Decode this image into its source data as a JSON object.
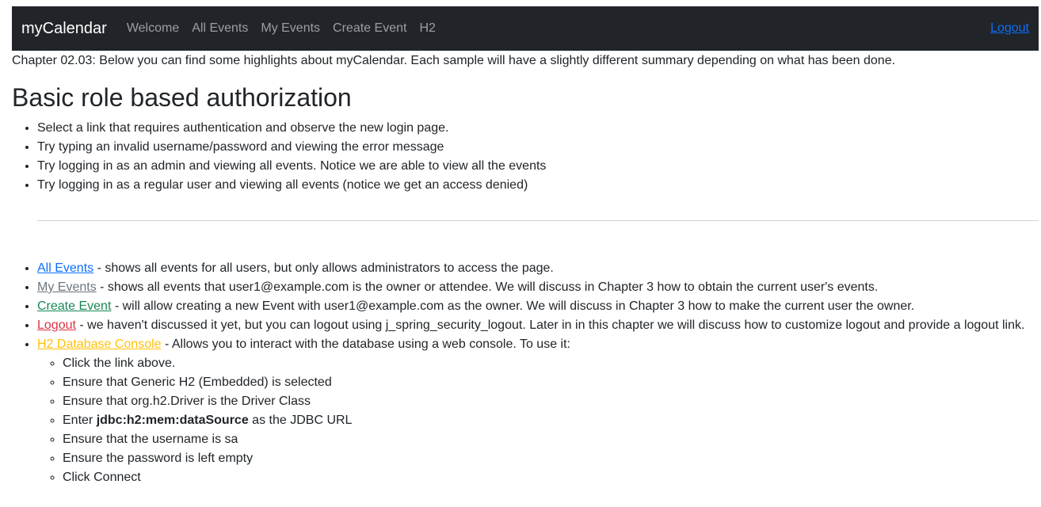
{
  "navbar": {
    "brand": "myCalendar",
    "links": [
      "Welcome",
      "All Events",
      "My Events",
      "Create Event",
      "H2"
    ],
    "logout": "Logout"
  },
  "intro": "Chapter 02.03: Below you can find some highlights about myCalendar. Each sample will have a slightly different summary depending on what has been done.",
  "heading": "Basic role based authorization",
  "steps": [
    "Select a link that requires authentication and observe the new login page.",
    "Try typing an invalid username/password and viewing the error message",
    "Try logging in as an admin and viewing all events. Notice we are able to view all the events",
    "Try logging in as a regular user and viewing all events (notice we get an access denied)"
  ],
  "features": [
    {
      "link": "All Events",
      "text": " - shows all events for all users, but only allows administrators to access the page."
    },
    {
      "link": "My Events",
      "text": " - shows all events that user1@example.com is the owner or attendee. We will discuss in Chapter 3 how to obtain the current user's events."
    },
    {
      "link": "Create Event",
      "text": " - will allow creating a new Event with user1@example.com as the owner. We will discuss in Chapter 3 how to make the current user the owner."
    },
    {
      "link": "Logout",
      "text": " - we haven't discussed it yet, but you can logout using j_spring_security_logout. Later in in this chapter we will discuss how to customize logout and provide a logout link."
    },
    {
      "link": "H2 Database Console",
      "text": " - Allows you to interact with the database using a web console. To use it:"
    }
  ],
  "h2_steps": {
    "click_link": "Click the link above.",
    "generic": "Ensure that Generic H2 (Embedded) is selected",
    "driver": "Ensure that org.h2.Driver is the Driver Class",
    "url_prefix": "Enter ",
    "url_value": "jdbc:h2:mem:dataSource",
    "url_suffix": " as the JDBC URL",
    "username": "Ensure that the username is sa",
    "password": "Ensure the password is left empty",
    "connect": "Click Connect"
  },
  "colors": {
    "navbar_bg": "#212529",
    "primary": "#0d6efd",
    "secondary": "#6c757d",
    "success": "#198754",
    "danger": "#dc3545",
    "warning": "#ffc107"
  }
}
